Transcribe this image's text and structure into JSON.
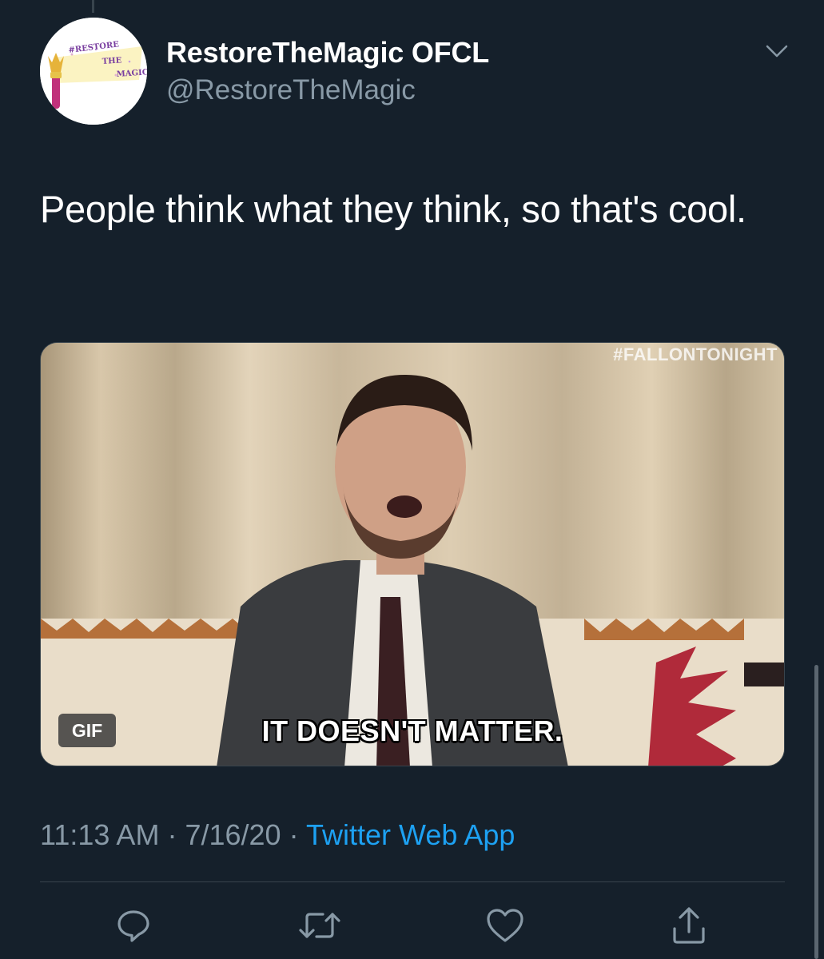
{
  "tweet": {
    "author": {
      "display_name": "RestoreTheMagic OFCL",
      "handle": "@RestoreTheMagic",
      "avatar_text": [
        "#RESTORE",
        "THE",
        "MAGIC"
      ]
    },
    "text": "People think what they think, so that's cool.",
    "media": {
      "type": "gif",
      "badge_label": "GIF",
      "watermark": "#FALLONTONIGHT",
      "caption": "IT DOESN'T MATTER."
    },
    "meta": {
      "time": "11:13 AM",
      "separator": "·",
      "date": "7/16/20",
      "source": "Twitter Web App"
    }
  },
  "actions": [
    {
      "name": "reply-icon"
    },
    {
      "name": "retweet-icon"
    },
    {
      "name": "like-icon"
    },
    {
      "name": "share-icon"
    }
  ],
  "colors": {
    "background": "#15202b",
    "text_primary": "#ffffff",
    "text_secondary": "#8899a6",
    "accent": "#1da1f2",
    "divider": "#38444d"
  }
}
